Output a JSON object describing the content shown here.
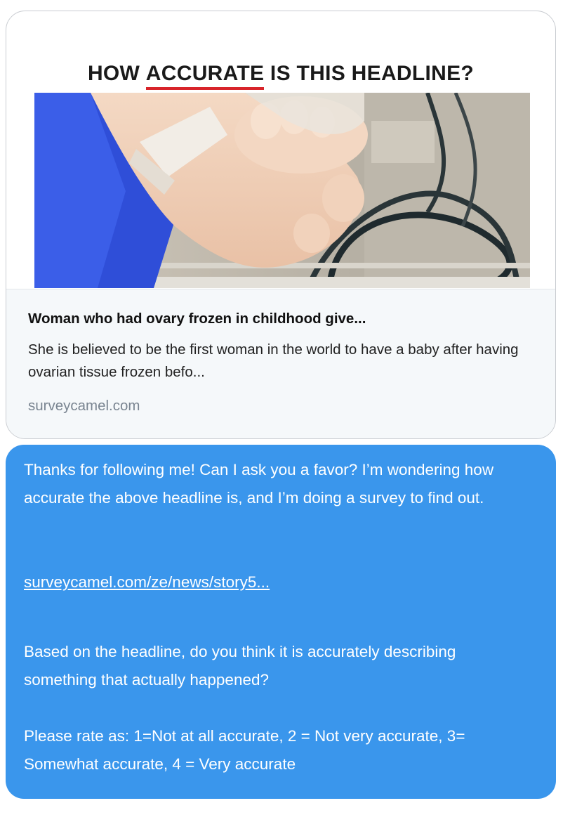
{
  "card": {
    "heading_pre": "HOW ",
    "heading_highlight": "ACCURATE",
    "heading_post": " IS THIS HEADLINE?",
    "link_title": "Woman who had ovary frozen in childhood give...",
    "link_description": "She is believed to be the first woman in the world to have a baby after having ovarian tissue frozen befo...",
    "link_domain": "surveycamel.com",
    "accent_color": "#d8242a"
  },
  "message": {
    "bubble_color": "#3a96ec",
    "paragraph_1": "Thanks for following me! Can I ask you a favor? I’m wondering how accurate the above headline is, and I’m doing a survey to find out.",
    "link": "surveycamel.com/ze/news/story5...",
    "paragraph_2": "Based on the headline, do you think it is accurately describing something that actually happened?",
    "paragraph_3": "Please rate as: 1=Not at all accurate, 2 = Not very accurate, 3= Somewhat accurate, 4 = Very accurate"
  }
}
